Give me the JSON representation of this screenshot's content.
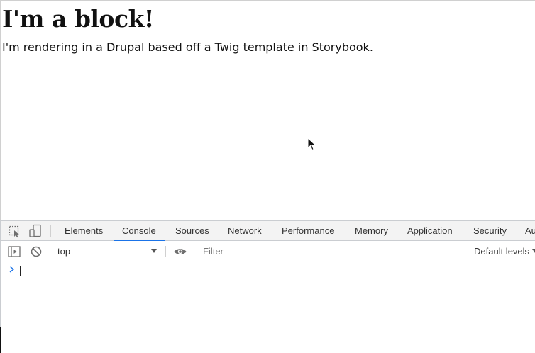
{
  "page": {
    "heading": "I'm a block!",
    "body_text": "I'm rendering in a Drupal based off a Twig template in Storybook."
  },
  "devtools": {
    "icons": {
      "inspect": "inspect-element-icon",
      "device": "device-toolbar-icon",
      "sidebar": "console-sidebar-icon",
      "clear": "clear-console-icon",
      "eye": "live-expression-eye-icon",
      "prompt": "console-prompt-chevron-icon"
    },
    "tabs": [
      "Elements",
      "Console",
      "Sources",
      "Network",
      "Performance",
      "Memory",
      "Application",
      "Security",
      "Au"
    ],
    "active_tab": "Console",
    "accent_color": "#1a73e8",
    "context_selector": "top",
    "filter_placeholder": "Filter",
    "levels_label": "Default levels"
  }
}
